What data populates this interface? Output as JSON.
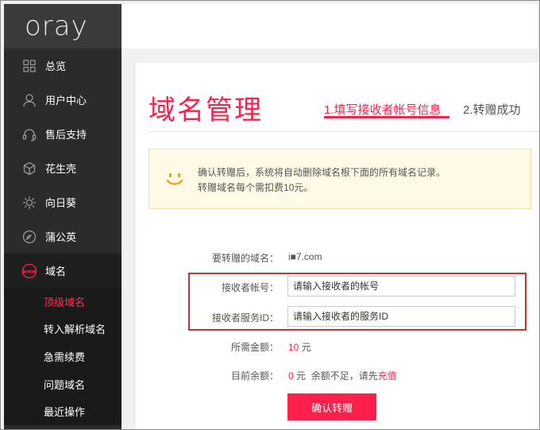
{
  "sidebar": {
    "logo": "oray",
    "items": [
      {
        "label": "总览",
        "icon": "grid-icon"
      },
      {
        "label": "用户中心",
        "icon": "user-icon"
      },
      {
        "label": "售后支持",
        "icon": "headset-icon"
      },
      {
        "label": "花生壳",
        "icon": "peanut-icon"
      },
      {
        "label": "向日葵",
        "icon": "sunflower-icon"
      },
      {
        "label": "蒲公英",
        "icon": "dandelion-icon"
      },
      {
        "label": "域名",
        "icon": "www-icon"
      }
    ],
    "sub_items": [
      {
        "label": "顶级域名",
        "active": true
      },
      {
        "label": "转入解析域名"
      },
      {
        "label": "急需续费"
      },
      {
        "label": "问题域名"
      },
      {
        "label": "最近操作"
      }
    ]
  },
  "main": {
    "title": "域名管理",
    "steps": [
      {
        "label": "1.填写接收者帐号信息",
        "active": true
      },
      {
        "label": "2.转赠成功"
      }
    ],
    "notice": {
      "line1": "确认转赠后，系统将自动删除域名根下面的所有域名记录。",
      "line2": "转赠域名每个需扣费10元。"
    },
    "form": {
      "domain_label": "要转赠的域名：",
      "domain_value": "i■7.com",
      "account_label": "接收者帐号：",
      "account_placeholder": "请输入接收者的帐号",
      "service_label": "接收者服务ID：",
      "service_placeholder": "请输入接收者的服务ID",
      "fee_label": "所需金额：",
      "fee_amount": "10",
      "fee_unit": "元",
      "balance_label": "目前余额：",
      "balance_amount": "0",
      "balance_unit": "元",
      "balance_note": "余额不足，请先",
      "recharge_link": "充值",
      "confirm_button": "确认转赠"
    }
  },
  "colors": {
    "accent": "#ff1f4b",
    "sidebar_bg": "#2b2b2b",
    "highlight_box": "#d42b2b"
  }
}
